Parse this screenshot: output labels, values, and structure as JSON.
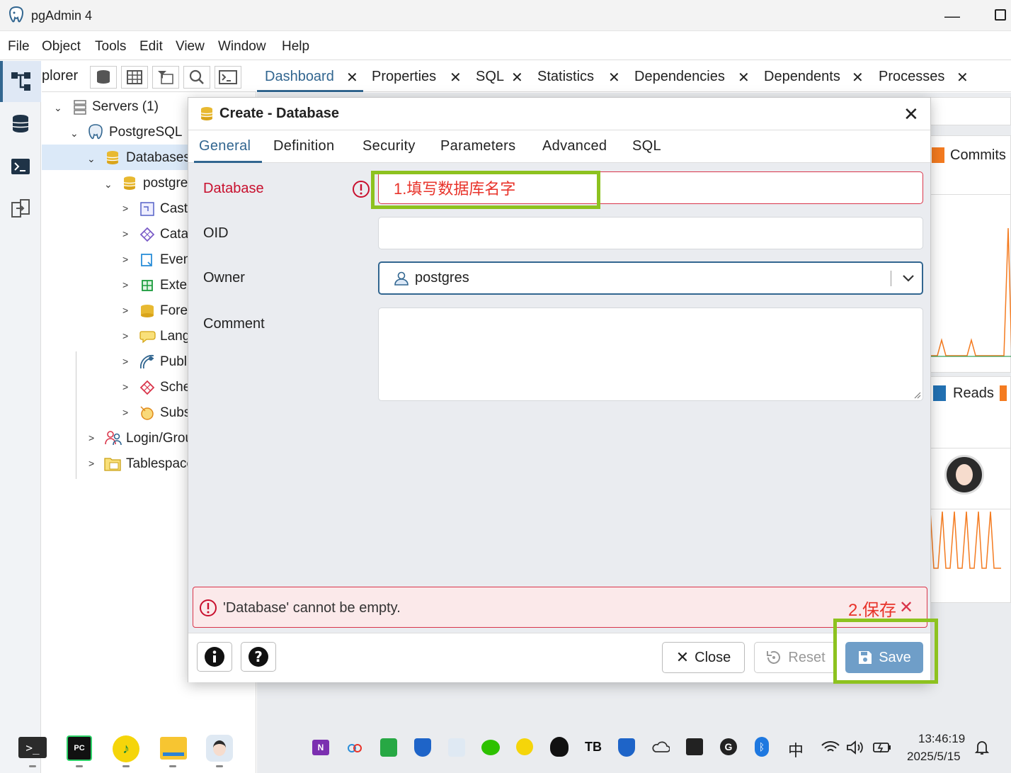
{
  "app": {
    "title": "pgAdmin 4"
  },
  "menu": [
    "File",
    "Object",
    "Tools",
    "Edit",
    "View",
    "Window",
    "Help"
  ],
  "explorer": {
    "header_label": "plorer",
    "tree": [
      {
        "label": "Servers (1)"
      },
      {
        "label": "PostgreSQL"
      },
      {
        "label": "Databases"
      },
      {
        "label": "postgres"
      },
      {
        "label": "Casts"
      },
      {
        "label": "Catalogs"
      },
      {
        "label": "Event Triggers"
      },
      {
        "label": "Extensions"
      },
      {
        "label": "Foreign Data Wrappers"
      },
      {
        "label": "Languages"
      },
      {
        "label": "Publications"
      },
      {
        "label": "Schemas"
      },
      {
        "label": "Subscriptions"
      },
      {
        "label": "Login/Group Roles"
      },
      {
        "label": "Tablespaces"
      }
    ]
  },
  "tabs": [
    "Dashboard",
    "Properties",
    "SQL",
    "Statistics",
    "Dependencies",
    "Dependents",
    "Processes"
  ],
  "dashboard": {
    "legend_commits": "Commits",
    "legend_reads": "Reads"
  },
  "dialog": {
    "title": "Create - Database",
    "tabs": [
      "General",
      "Definition",
      "Security",
      "Parameters",
      "Advanced",
      "SQL"
    ],
    "fields": {
      "database_label": "Database",
      "database_annotation": "1.填写数据库名字",
      "oid_label": "OID",
      "owner_label": "Owner",
      "owner_value": "postgres",
      "comment_label": "Comment"
    },
    "error_message": "'Database' cannot be empty.",
    "save_annotation": "2.保存",
    "buttons": {
      "close": "Close",
      "reset": "Reset",
      "save": "Save"
    }
  },
  "taskbar": {
    "time": "13:46:19",
    "date": "2025/5/15",
    "ime": "中"
  },
  "colors": {
    "accent": "#326690",
    "error": "#d9344a",
    "highlight": "#8dc21f",
    "save_bg": "#6f9ec8"
  }
}
